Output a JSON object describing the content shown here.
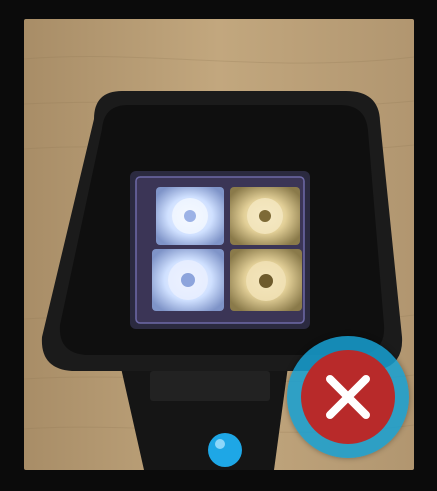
{
  "image": {
    "subject": "photo",
    "colors": {
      "frame": "#0b0b0b",
      "table": "#b59a72",
      "housing": "#1a1a1a",
      "led_cool": "#d8e6ff",
      "led_warm": "#e8d6a0",
      "indicator": "#1ea7e6"
    }
  },
  "overlay": {
    "close_button": {
      "icon": "close-icon",
      "ring_color": "#1aa3d6",
      "fill_color": "#b82a2a"
    }
  }
}
